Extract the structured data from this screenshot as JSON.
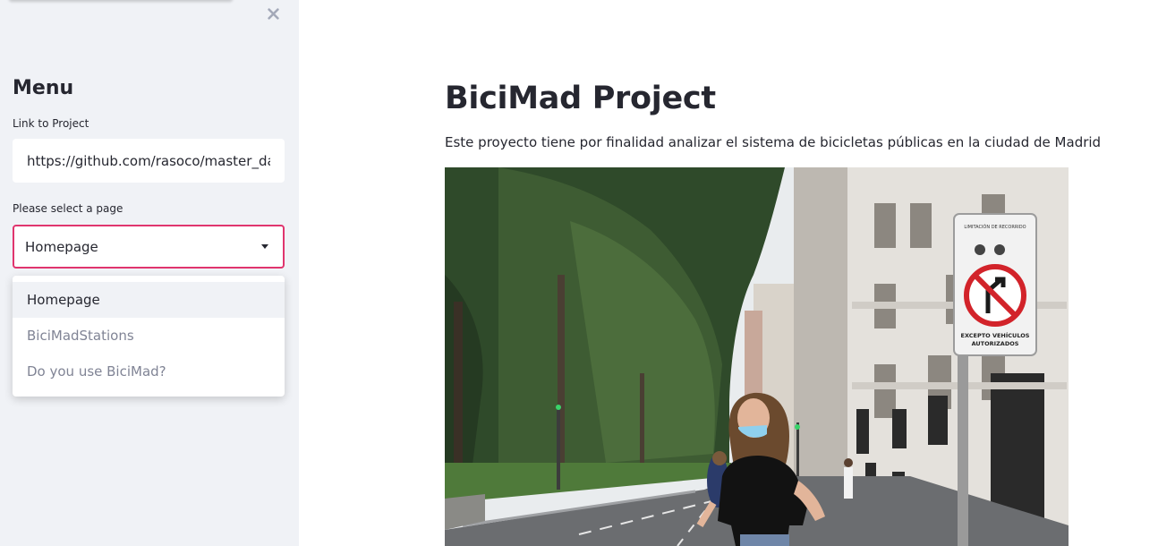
{
  "sidebar": {
    "close_icon": "close-icon",
    "menu_title": "Menu",
    "link_label": "Link to Project",
    "link_value": "https://github.com/rasoco/master_dat",
    "select_label": "Please select a page",
    "select_value": "Homepage",
    "options": [
      {
        "label": "Homepage",
        "selected": true
      },
      {
        "label": "BiciMadStations",
        "selected": false
      },
      {
        "label": "Do you use BiciMad?",
        "selected": false
      }
    ],
    "accent_color": "#e0356e"
  },
  "main": {
    "title": "BiciMad Project",
    "subtitle": "Este proyecto tiene por finalidad analizar el sistema de bicicletas públicas en la ciudad de Madrid",
    "sign": {
      "top_line": "LIMITACIÓN DE RECORRIDO",
      "bottom_line1": "EXCEPTO VEHÍCULOS",
      "bottom_line2": "AUTORIZADOS"
    }
  }
}
